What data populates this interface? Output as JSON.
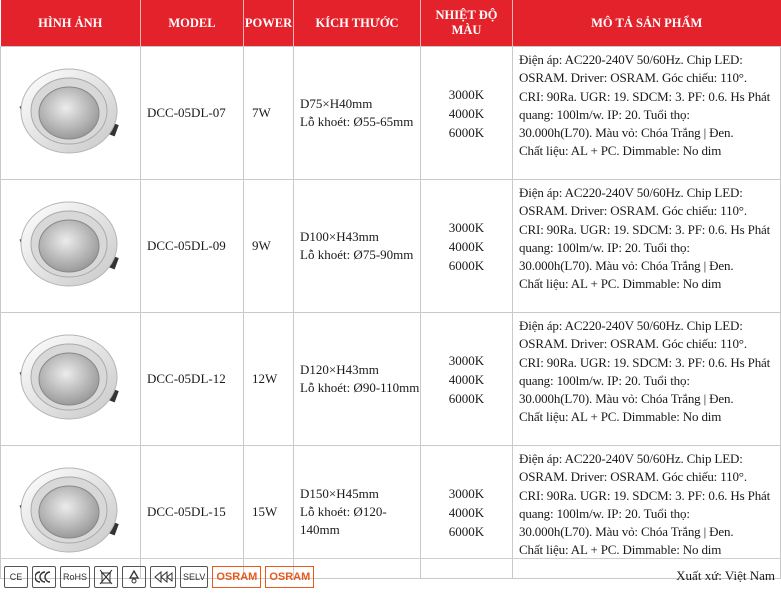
{
  "headers": [
    "HÌNH ẢNH",
    "MODEL",
    "POWER",
    "KÍCH THƯỚC",
    "NHIỆT ĐỘ MÀU",
    "MÔ TẢ SẢN PHẨM"
  ],
  "products": [
    {
      "model": "DCC-05DL-07",
      "power": "7W",
      "size": "D75×H40mm",
      "cutout": "Lỗ khoét: Ø55-65mm",
      "cct": [
        "3000K",
        "4000K",
        "6000K"
      ],
      "desc": [
        "Điện áp: AC220-240V 50/60Hz. Chip LED:",
        "OSRAM. Driver: OSRAM. Góc chiếu: 110°.",
        "CRI: 90Ra. UGR: 19. SDCM: 3. PF: 0.6. Hs Phát",
        "quang: 100lm/w. IP: 20. Tuổi thọ:",
        "30.000h(L70). Màu vỏ: Chóa Trắng | Đen.",
        "Chất liệu: AL + PC. Dimmable: No dim"
      ]
    },
    {
      "model": "DCC-05DL-09",
      "power": "9W",
      "size": "D100×H43mm",
      "cutout": "Lỗ khoét:  Ø75-90mm",
      "cct": [
        "3000K",
        "4000K",
        "6000K"
      ],
      "desc": [
        "Điện áp: AC220-240V 50/60Hz. Chip LED:",
        "OSRAM. Driver: OSRAM. Góc chiếu: 110°.",
        "CRI: 90Ra. UGR: 19. SDCM: 3. PF: 0.6. Hs Phát",
        "quang: 100lm/w. IP: 20. Tuổi thọ:",
        "30.000h(L70). Màu vỏ: Chóa Trắng | Đen.",
        "Chất liệu: AL + PC. Dimmable: No dim"
      ]
    },
    {
      "model": "DCC-05DL-12",
      "power": "12W",
      "size": "D120×H43mm",
      "cutout": "Lỗ khoét:  Ø90-110mm",
      "cct": [
        "3000K",
        "4000K",
        "6000K"
      ],
      "desc": [
        "Điện áp: AC220-240V 50/60Hz. Chip LED:",
        "OSRAM. Driver: OSRAM. Góc chiếu: 110°.",
        "CRI: 90Ra. UGR: 19. SDCM: 3. PF: 0.6. Hs Phát",
        "quang: 100lm/w. IP: 20. Tuổi thọ:",
        "30.000h(L70). Màu vỏ: Chóa Trắng | Đen.",
        "Chất liệu: AL + PC. Dimmable: No dim"
      ]
    },
    {
      "model": "DCC-05DL-15",
      "power": "15W",
      "size": "D150×H45mm",
      "cutout": "Lỗ khoét:  Ø120-140mm",
      "cct": [
        "3000K",
        "4000K",
        "6000K"
      ],
      "desc": [
        "Điện áp: AC220-240V 50/60Hz. Chip LED:",
        "OSRAM. Driver: OSRAM. Góc chiếu: 110°.",
        "CRI: 90Ra. UGR: 19. SDCM: 3. PF: 0.6. Hs Phát",
        "quang: 100lm/w. IP: 20. Tuổi thọ:",
        "30.000h(L70). Màu vỏ: Chóa Trắng | Đen.",
        "Chất liệu: AL + PC. Dimmable: No dim"
      ]
    }
  ],
  "certifications": [
    "CE",
    "CCC",
    "RoHS",
    "WEEE",
    "Recycle",
    "SELV",
    "OSRAM",
    "OSRAM"
  ],
  "cert_labels": {
    "ce": "CE",
    "rohs": "RoHS",
    "selv": "SELV",
    "osram1": "OSRAM",
    "osram2": "OSRAM"
  },
  "origin": "Xuất xứ: Việt Nam",
  "colors": {
    "header_bg": "#e4222b",
    "osram": "#e65a1c"
  }
}
